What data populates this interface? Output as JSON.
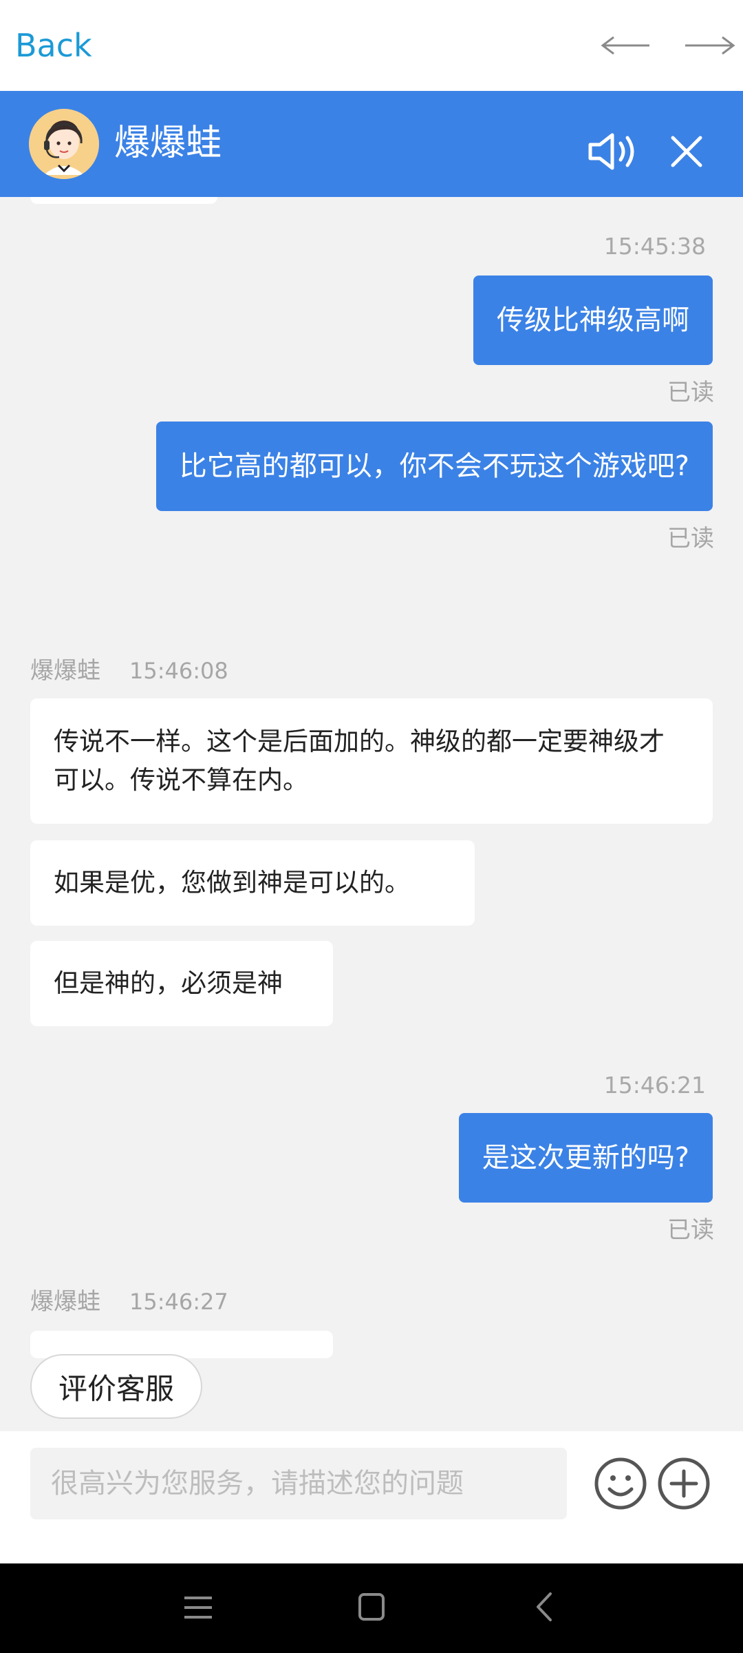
{
  "browser": {
    "back_label": "Back"
  },
  "header": {
    "agent_name": "爆爆蛙"
  },
  "chat": {
    "messages": [
      {
        "time": "15:45:38"
      },
      {
        "text": "传级比神级高啊",
        "status": "已读"
      },
      {
        "text": "比它高的都可以，你不会不玩这个游戏吧?",
        "status": "已读"
      },
      {
        "sender": "爆爆蛙",
        "time": "15:46:08"
      },
      {
        "text": "传说不一样。这个是后面加的。神级的都一定要神级才可以。传说不算在内。"
      },
      {
        "text": "如果是优，您做到神是可以的。"
      },
      {
        "text": "但是神的，必须是神"
      },
      {
        "time": "15:46:21"
      },
      {
        "text": "是这次更新的吗?",
        "status": "已读"
      },
      {
        "sender": "爆爆蛙",
        "time": "15:46:27"
      }
    ]
  },
  "rate_button": {
    "label": "评价客服"
  },
  "input": {
    "placeholder": "很高兴为您服务，请描述您的问题"
  },
  "colors": {
    "accent": "#3b82e6",
    "link": "#1b9ad6",
    "muted": "#a6a6a6"
  },
  "icons": [
    "arrow-left-icon",
    "arrow-right-icon",
    "speaker-icon",
    "close-icon",
    "emoji-icon",
    "plus-icon",
    "menu-icon",
    "home-icon",
    "back-chevron-icon"
  ]
}
